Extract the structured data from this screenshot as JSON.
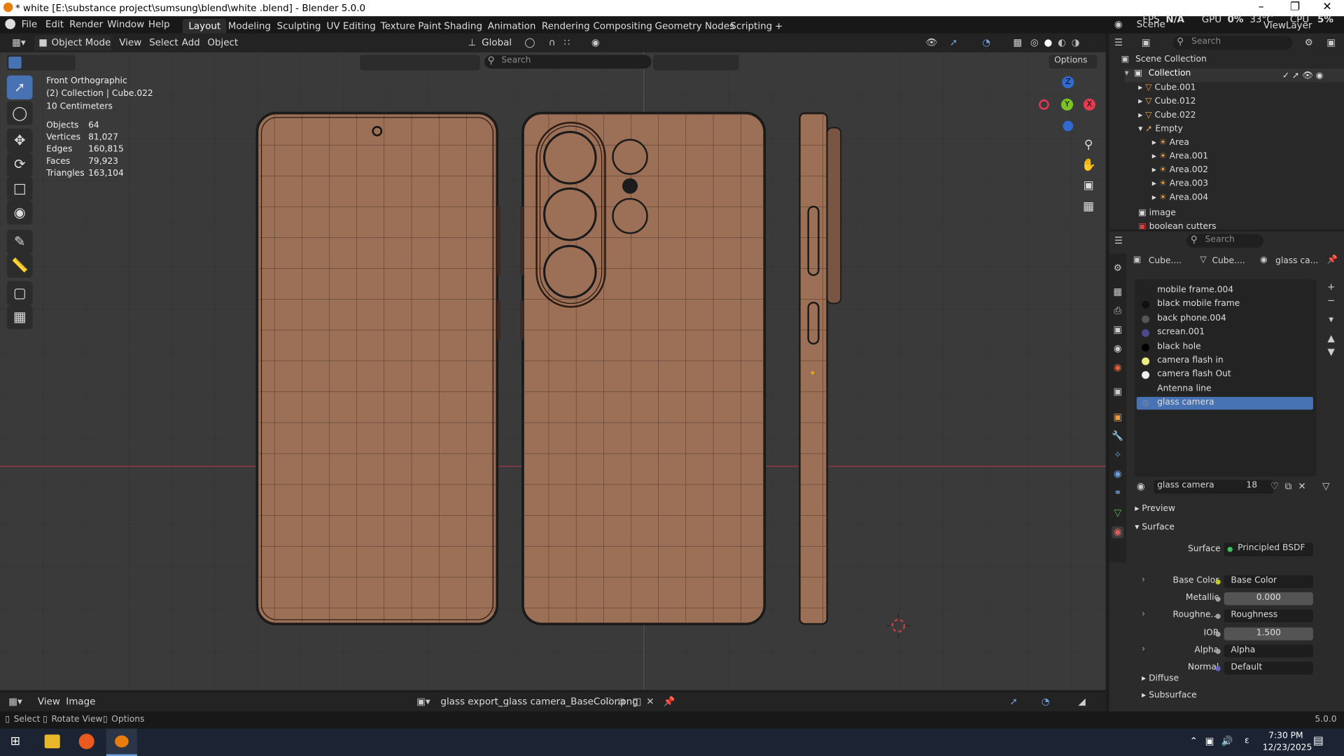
{
  "window": {
    "title": "* white [E:\\substance project\\sumsung\\blend\\white .blend] - Blender 5.0.0",
    "min": "–",
    "max": "❐",
    "close": "✕"
  },
  "menu": {
    "items": [
      "File",
      "Edit",
      "Render",
      "Window",
      "Help"
    ]
  },
  "workspaces": [
    "Layout",
    "Modeling",
    "Sculpting",
    "UV Editing",
    "Texture Paint",
    "Shading",
    "Animation",
    "Rendering",
    "Compositing",
    "Geometry Nodes",
    "Scripting",
    "+"
  ],
  "topright": {
    "scene": "Scene",
    "fps": "FPS",
    "na": "N/A",
    "gpu": "GPU",
    "gpu_val": "0%",
    "temp": "33°C",
    "cpu": "CPU",
    "cpu_val": "5%",
    "view_layer": "ViewLayer"
  },
  "viewport_header": {
    "mode": "Object Mode",
    "view": "View",
    "select": "Select",
    "add": "Add",
    "object": "Object",
    "transform": "Global",
    "search_placeholder": "Search",
    "options": "Options"
  },
  "viewport": {
    "view_name": "Front Orthographic",
    "collection": "(2) Collection | Cube.022",
    "scale": "10 Centimeters",
    "stats": [
      [
        "Objects",
        "64"
      ],
      [
        "Vertices",
        "81,027"
      ],
      [
        "Edges",
        "160,815"
      ],
      [
        "Faces",
        "79,923"
      ],
      [
        "Triangles",
        "163,104"
      ]
    ]
  },
  "gizmo": {
    "z": "Z",
    "y": "Y",
    "x": "X"
  },
  "outliner": {
    "search_placeholder": "Search",
    "root": "Scene Collection",
    "collection": "Collection",
    "items": [
      "Cube.001",
      "Cube.012",
      "Cube.022",
      "Empty",
      "Area",
      "Area.001",
      "Area.002",
      "Area.003",
      "Area.004",
      "image",
      "boolean cutters"
    ]
  },
  "properties": {
    "search_placeholder": "Search",
    "breadcrumb": [
      "Cube....",
      "Cube....",
      "glass ca..."
    ],
    "materials": [
      "mobile frame.004",
      "black mobile frame",
      "back phone.004",
      "screan.001",
      "black hole",
      "camera flash in",
      "camera flash Out",
      "Antenna line",
      "glass camera"
    ],
    "material_name": "glass camera",
    "users": "18",
    "sections": {
      "preview": "Preview",
      "surface": "Surface",
      "diffuse": "Diffuse",
      "subsurface": "Subsurface"
    },
    "surface": {
      "label": "Surface",
      "value": "Principled BSDF"
    },
    "inputs": [
      {
        "label": "Base Color",
        "value": "Base Color",
        "color": "#c7c729"
      },
      {
        "label": "Metallic",
        "value": "0.000",
        "color": "#a1a1a1"
      },
      {
        "label": "Roughne...",
        "value": "Roughness",
        "color": "#a1a1a1"
      },
      {
        "label": "IOR",
        "value": "1.500",
        "color": "#a1a1a1"
      },
      {
        "label": "Alpha",
        "value": "Alpha",
        "color": "#a1a1a1"
      },
      {
        "label": "Normal",
        "value": "Default",
        "color": "#6363c7"
      }
    ]
  },
  "image_editor": {
    "view": "View",
    "image": "Image",
    "filename": "glass export_glass camera_BaseColor.png"
  },
  "statusbar": {
    "select": "Select",
    "rotate": "Rotate View",
    "options": "Options",
    "version": "5.0.0"
  },
  "taskbar": {
    "time": "7:30 PM",
    "date": "12/23/2025"
  },
  "colors": {
    "accent": "#4772b3",
    "phone": "#9c7056",
    "grid_line": "#2e2e2e",
    "x_axis": "#a0384a"
  }
}
